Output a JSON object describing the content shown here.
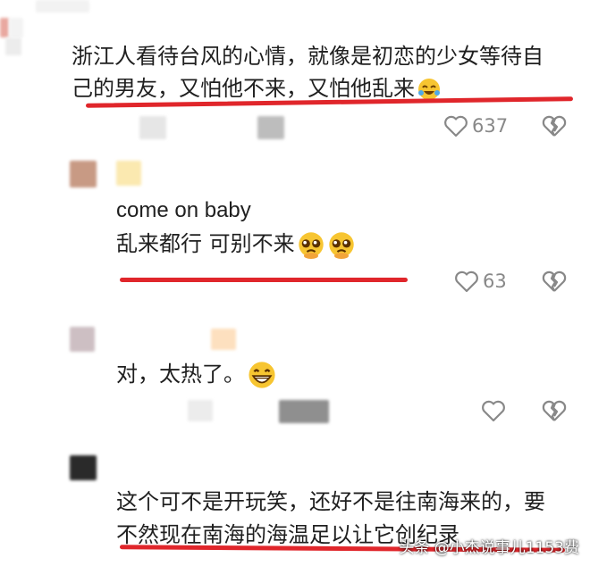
{
  "comments": [
    {
      "lines": [
        "浙江人看待台风的心情，就像是初恋的少女等待自",
        "己的男友，又怕他不来，又怕他乱来"
      ],
      "emoji": [
        "laughing-crying-emoji"
      ],
      "likes": "637"
    },
    {
      "lines": [
        "come on  baby",
        "乱来都行  可别不来"
      ],
      "emoji": [
        "pleading-face-emoji",
        "pleading-face-emoji"
      ],
      "likes": "63"
    },
    {
      "lines": [
        "对，太热了。"
      ],
      "emoji": [
        "grinning-face-emoji"
      ],
      "likes": ""
    },
    {
      "lines": [
        "这个可不是开玩笑，还好不是往南海来的，要",
        "不然现在南海的海温足以让它创纪录"
      ],
      "emoji": [],
      "likes": ""
    }
  ],
  "watermark": "头条 @小杰说事儿1153费",
  "colors": {
    "underline": "#e0262b",
    "icon": "#888888",
    "text": "#1f1f1f"
  },
  "icons": {
    "like": "heart-outline-icon",
    "dislike": "broken-heart-icon"
  }
}
